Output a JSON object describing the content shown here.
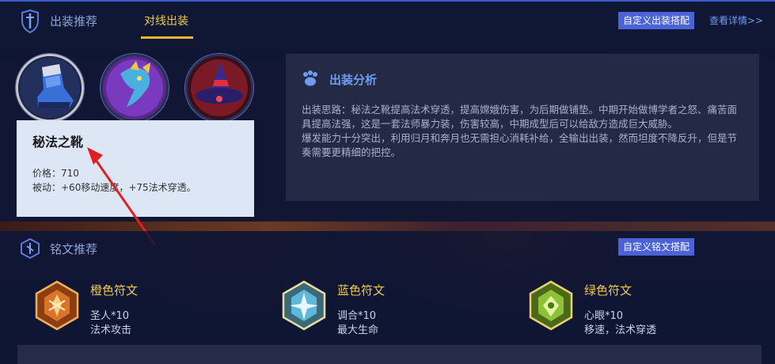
{
  "header": {
    "title": "出装推荐",
    "tab_label": "对线出装",
    "custom_build_button": "自定义出装搭配",
    "more_link": "查看详情>>"
  },
  "items": [
    {
      "icon": "boots-icon"
    },
    {
      "icon": "dragon-scepter-icon"
    },
    {
      "icon": "wizard-hat-icon"
    }
  ],
  "tooltip": {
    "name": "秘法之靴",
    "price": "价格：710",
    "passive": "被动：+60移动速度，+75法术穿透。"
  },
  "analysis": {
    "title": "出装分析",
    "paragraph1": "出装思路：秘法之靴提高法术穿透，提高嫦娥伤害，为后期做铺垫。中期开始做博学者之怒、痛苦面具提高法强，这是一套法师暴力装，伤害较高，中期成型后可以给敌方造成巨大威胁。",
    "paragraph2": "爆发能力十分突出，利用归月和奔月也无需担心消耗补给，全输出出装，然而坦度不降反升，但是节奏需要更精细的把控。"
  },
  "runes_section": {
    "title": "铭文推荐",
    "custom_rune_button": "自定义铭文搭配",
    "runes": [
      {
        "name": "橙色符文",
        "line1": "圣人*10",
        "line2": "法术攻击",
        "color": "#d9742a"
      },
      {
        "name": "蓝色符文",
        "line1": "调合*10",
        "line2": "最大生命",
        "color": "#5fb8d8"
      },
      {
        "name": "绿色符文",
        "line1": "心眼*10",
        "line2": "移速，法术穿透",
        "color": "#8fc03a"
      }
    ]
  },
  "colors": {
    "accent_blue": "#4b63d6",
    "tab_gold": "#f2c94c",
    "link_blue": "#6f9cf0"
  }
}
